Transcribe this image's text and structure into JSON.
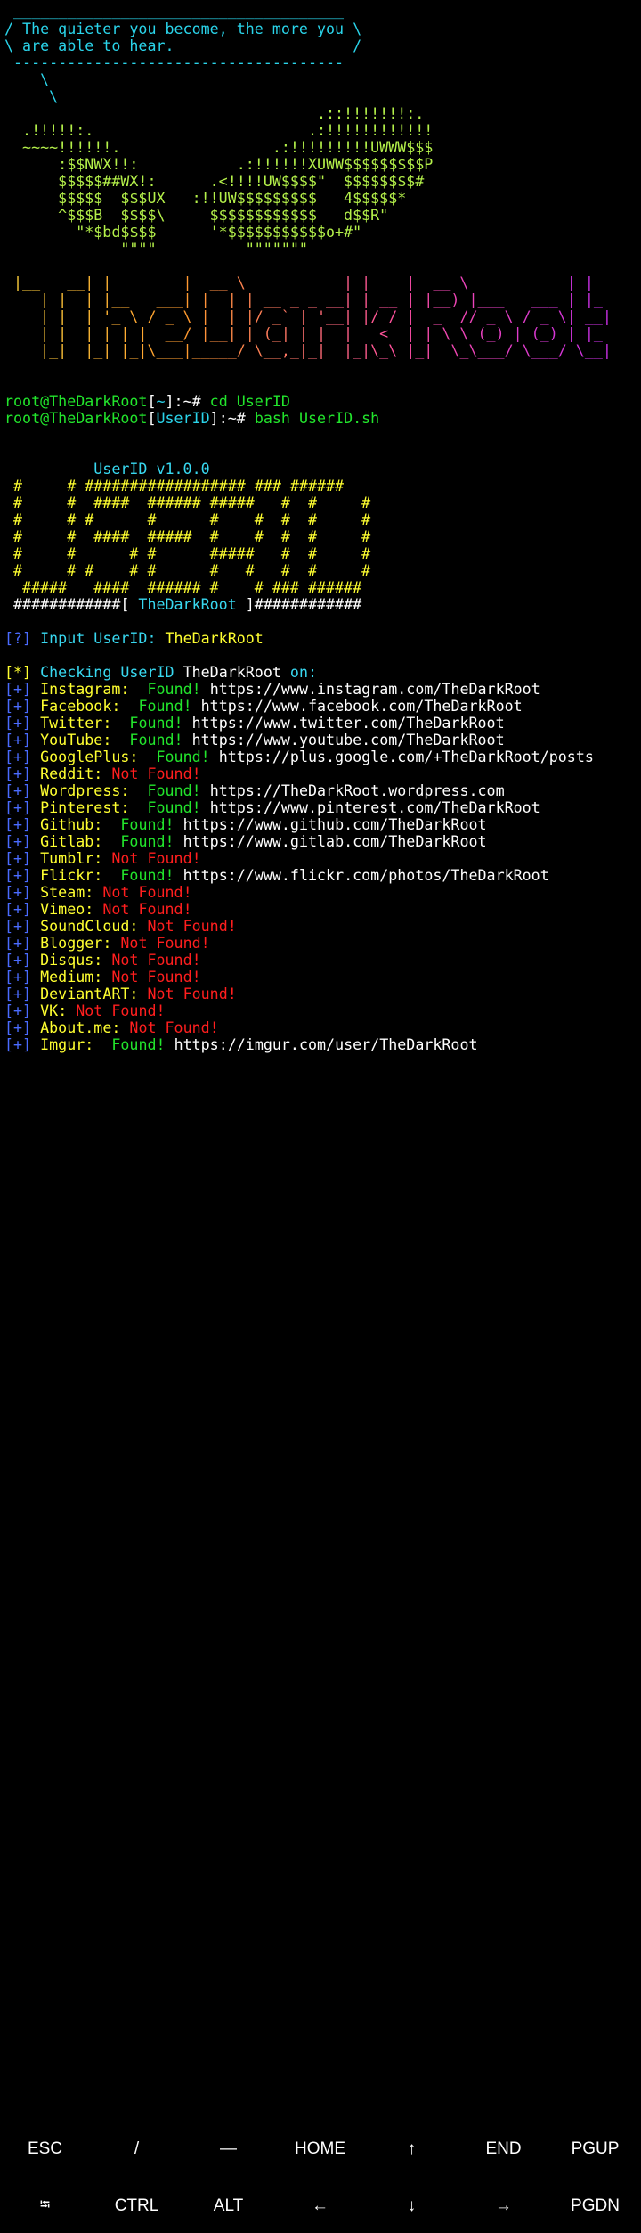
{
  "theme": {
    "background": "#000000",
    "cyan": "#2ad4ea",
    "green": "#22e52c",
    "red": "#ff1e1e",
    "yellow": "#ffff30",
    "blue": "#4a6bff",
    "banner_gradient": [
      "#ffd43b",
      "#ff9a2e",
      "#ff4fa0",
      "#c92fe8"
    ]
  },
  "cowsay": {
    "top": " _____________________________________",
    "line1": "/ The quieter you become, the more you \\",
    "line2": "\\ are able to hear.                    /",
    "bottom": " -------------------------------------",
    "tail1": "    \\",
    "tail2": "     \\"
  },
  "dragon": [
    "                                   .::!!!!!!!:.",
    "  .!!!!!:.                        .:!!!!!!!!!!!!",
    "  ~~~~!!!!!!.                 .:!!!!!!!!!UWWW$$$",
    "      :$$NWX!!:           .:!!!!!!XUWW$$$$$$$$$P",
    "      $$$$$##WX!:      .<!!!!UW$$$$\"  $$$$$$$$#",
    "      $$$$$  $$$UX   :!!UW$$$$$$$$$   4$$$$$*",
    "      ^$$$B  $$$$\\     $$$$$$$$$$$$   d$$R\"",
    "        \"*$bd$$$$      '*$$$$$$$$$$$o+#\"",
    "             \"\"\"\"          \"\"\"\"\"\"\""
  ],
  "banner": [
    "  _______ _          _____             _      _____             _",
    " |__   __| |        |  __ \\           | |    |  __ \\           | |",
    "    | |  | |__   ___| |  | | __ _ _ __| | __ | |__) |___   ___ | |_",
    "    | |  | '_ \\ / _ \\ |  | |/ _` | '__| |/ / |  _  // _ \\ / _ \\| __|",
    "    | |  | | | |  __/ |__| | (_| | |  |   <  | | \\ \\ (_) | (_) | |_",
    "    |_|  |_| |_|\\___|_____/ \\__,_|_|  |_|\\_\\ |_|  \\_\\___/ \\___/ \\__|"
  ],
  "session": {
    "prompt_user": "root@TheDarkRoot",
    "cmd1_path": "~",
    "cmd1": "cd UserID",
    "cmd2_path": "UserID",
    "cmd2": "bash UserID.sh",
    "prompt_suffix": ":~# "
  },
  "tool": {
    "title": "          UserID v1.0.0",
    "logo": [
      " #     # ################## ### ######",
      " #     #  ####  ###### #####   #  #     #",
      " #     # #      #      #    #  #  #     #",
      " #     #  ####  #####  #    #  #  #     #",
      " #     #      # #      #####   #  #     #",
      " #     # #    # #      #   #   #  #     #",
      "  #####   ####  ###### #    # ### ######"
    ],
    "footer_left": " ############[ ",
    "footer_name": "TheDarkRoot",
    "footer_right": " ]############",
    "input_mark": "[?]",
    "input_label": " Input UserID: ",
    "input_value": "TheDarkRoot",
    "check_mark": "[*]",
    "check_label": " Checking UserID ",
    "check_user": "TheDarkRoot",
    "check_suffix": " on:"
  },
  "results": [
    {
      "site": "Instagram",
      "status": "found",
      "url": "https://www.instagram.com/TheDarkRoot"
    },
    {
      "site": "Facebook",
      "status": "found",
      "url": "https://www.facebook.com/TheDarkRoot"
    },
    {
      "site": "Twitter",
      "status": "found",
      "url": "https://www.twitter.com/TheDarkRoot"
    },
    {
      "site": "YouTube",
      "status": "found",
      "url": "https://www.youtube.com/TheDarkRoot"
    },
    {
      "site": "GooglePlus",
      "status": "found",
      "url": "https://plus.google.com/+TheDarkRoot/posts"
    },
    {
      "site": "Reddit",
      "status": "not_found",
      "url": ""
    },
    {
      "site": "Wordpress",
      "status": "found",
      "url": "https://TheDarkRoot.wordpress.com"
    },
    {
      "site": "Pinterest",
      "status": "found",
      "url": "https://www.pinterest.com/TheDarkRoot"
    },
    {
      "site": "Github",
      "status": "found",
      "url": "https://www.github.com/TheDarkRoot"
    },
    {
      "site": "Gitlab",
      "status": "found",
      "url": "https://www.gitlab.com/TheDarkRoot"
    },
    {
      "site": "Tumblr",
      "status": "not_found",
      "url": ""
    },
    {
      "site": "Flickr",
      "status": "found",
      "url": "https://www.flickr.com/photos/TheDarkRoot"
    },
    {
      "site": "Steam",
      "status": "not_found",
      "url": ""
    },
    {
      "site": "Vimeo",
      "status": "not_found",
      "url": ""
    },
    {
      "site": "SoundCloud",
      "status": "not_found",
      "url": ""
    },
    {
      "site": "Blogger",
      "status": "not_found",
      "url": ""
    },
    {
      "site": "Disqus",
      "status": "not_found",
      "url": ""
    },
    {
      "site": "Medium",
      "status": "not_found",
      "url": ""
    },
    {
      "site": "DeviantART",
      "status": "not_found",
      "url": ""
    },
    {
      "site": "VK",
      "status": "not_found",
      "url": ""
    },
    {
      "site": "About.me",
      "status": "not_found",
      "url": ""
    },
    {
      "site": "Imgur",
      "status": "found",
      "url": "https://imgur.com/user/TheDarkRoot"
    }
  ],
  "result_text": {
    "mark": "[+]",
    "found": "Found!",
    "not_found": "Not Found!"
  },
  "extra_keys": {
    "row1": [
      {
        "name": "esc",
        "label": "ESC"
      },
      {
        "name": "slash",
        "label": "/"
      },
      {
        "name": "dash",
        "label": "—"
      },
      {
        "name": "home",
        "label": "HOME"
      },
      {
        "name": "up-arrow",
        "label": "↑"
      },
      {
        "name": "end",
        "label": "END"
      },
      {
        "name": "pgup",
        "label": "PGUP"
      }
    ],
    "row2": [
      {
        "name": "tab",
        "label": "⭾"
      },
      {
        "name": "ctrl",
        "label": "CTRL"
      },
      {
        "name": "alt",
        "label": "ALT"
      },
      {
        "name": "left-arrow",
        "label": "←"
      },
      {
        "name": "down-arrow",
        "label": "↓"
      },
      {
        "name": "right-arrow",
        "label": "→"
      },
      {
        "name": "pgdn",
        "label": "PGDN"
      }
    ]
  }
}
